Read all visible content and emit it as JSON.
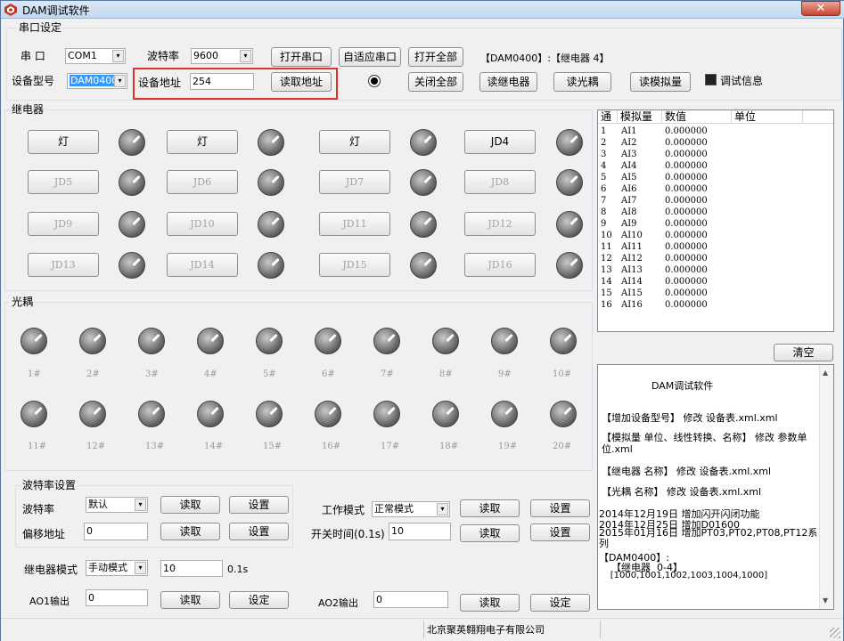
{
  "window": {
    "title": "DAM调试软件",
    "close": "✕"
  },
  "serial": {
    "group_label": "串口设定",
    "port_label": "串  口",
    "port_value": "COM1",
    "baud_label": "波特率",
    "baud_value": "9600",
    "open_port": "打开串口",
    "auto_port": "自适应串口",
    "open_all": "打开全部",
    "device_info": "【DAM0400】:【继电器  4】",
    "model_label": "设备型号",
    "model_value": "DAM0400",
    "addr_label": "设备地址",
    "addr_value": "254",
    "read_addr": "读取地址",
    "close_all": "关闭全部",
    "read_relay": "读继电器",
    "read_optical": "读光耦",
    "read_analog": "读模拟量",
    "debug_label": "调试信息"
  },
  "relay": {
    "group_label": "继电器",
    "buttons": [
      "灯",
      "灯",
      "灯",
      "JD4",
      "JD5",
      "JD6",
      "JD7",
      "JD8",
      "JD9",
      "JD10",
      "JD11",
      "JD12",
      "JD13",
      "JD14",
      "JD15",
      "JD16"
    ]
  },
  "optical": {
    "group_label": "光耦",
    "labels": [
      "1#",
      "2#",
      "3#",
      "4#",
      "5#",
      "6#",
      "7#",
      "8#",
      "9#",
      "10#",
      "11#",
      "12#",
      "13#",
      "14#",
      "15#",
      "16#",
      "17#",
      "18#",
      "19#",
      "20#"
    ]
  },
  "baudset": {
    "group_label": "波特率设置",
    "baud_label": "波特率",
    "baud_value": "默认",
    "offset_label": "偏移地址",
    "offset_value": "0",
    "read": "读取",
    "set": "设置",
    "work_mode_label": "工作模式",
    "work_mode_value": "正常模式",
    "switch_time_label": "开关时间(0.1s)",
    "switch_time_value": "10",
    "relay_mode_label": "继电器模式",
    "relay_mode_value": "手动模式",
    "relay_time_value": "10",
    "relay_time_unit": "0.1s",
    "ao1_label": "AO1输出",
    "ao1_value": "0",
    "ao2_label": "AO2输出",
    "ao2_value": "0",
    "confirm": "设定"
  },
  "analog_table": {
    "headers": [
      "通",
      "模拟量",
      "数值",
      "单位"
    ],
    "rows": [
      [
        "1",
        "AI1",
        "0.000000"
      ],
      [
        "2",
        "AI2",
        "0.000000"
      ],
      [
        "3",
        "AI3",
        "0.000000"
      ],
      [
        "4",
        "AI4",
        "0.000000"
      ],
      [
        "5",
        "AI5",
        "0.000000"
      ],
      [
        "6",
        "AI6",
        "0.000000"
      ],
      [
        "7",
        "AI7",
        "0.000000"
      ],
      [
        "8",
        "AI8",
        "0.000000"
      ],
      [
        "9",
        "AI9",
        "0.000000"
      ],
      [
        "10",
        "AI10",
        "0.000000"
      ],
      [
        "11",
        "AI11",
        "0.000000"
      ],
      [
        "12",
        "AI12",
        "0.000000"
      ],
      [
        "13",
        "AI13",
        "0.000000"
      ],
      [
        "14",
        "AI14",
        "0.000000"
      ],
      [
        "15",
        "AI15",
        "0.000000"
      ],
      [
        "16",
        "AI16",
        "0.000000"
      ]
    ]
  },
  "clear_button": "清空",
  "memo": {
    "title": "DAM调试软件",
    "lines": [
      "【增加设备型号】 修改  设备表.xml.xml",
      "【模拟量 单位、线性转换、名称】 修改 参数单位.xml",
      "【继电器 名称】 修改  设备表.xml.xml",
      "【光耦 名称】 修改  设备表.xml.xml",
      "2014年12月19日   增加闪开闪闭功能",
      "2014年12月25日   增加D01600",
      "2015年01月16日   增加PT03,PT02,PT08,PT12系列",
      "【DAM0400】:",
      "    【继电器  0-4】",
      "    [1000,1001,1002,1003,1004,1000]"
    ]
  },
  "status": {
    "company": "北京聚英翱翔电子有限公司"
  }
}
